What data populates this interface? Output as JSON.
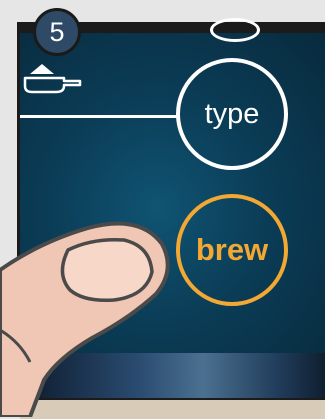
{
  "step": {
    "number": "5"
  },
  "buttons": {
    "type_label": "type",
    "brew_label": "brew"
  },
  "icons": {
    "scoop": "coffee-scoop-icon",
    "finger": "pointing-finger"
  },
  "colors": {
    "screen_bg": "#0b3d57",
    "type_ring": "#ffffff",
    "brew_ring": "#f2a832",
    "step_badge": "#2e4a66"
  }
}
